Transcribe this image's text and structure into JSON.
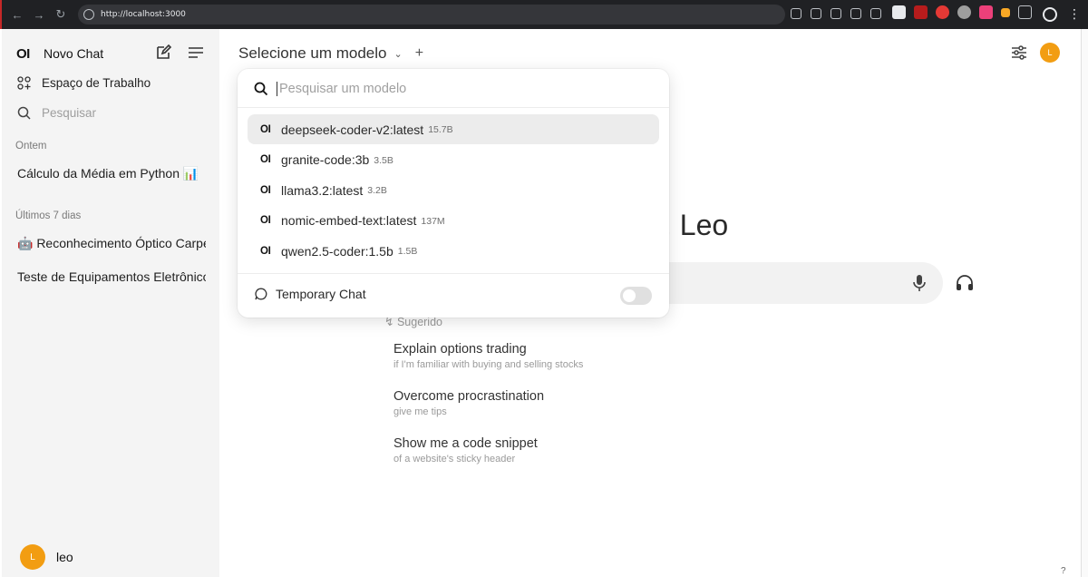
{
  "browser": {
    "url": "http://localhost:3000"
  },
  "sidebar": {
    "logo": "OI",
    "new_chat": "Novo Chat",
    "workspace": "Espaço de Trabalho",
    "search_placeholder": "Pesquisar",
    "groups": [
      {
        "label": "Ontem",
        "chats": [
          "Cálculo da Média em Python 📊"
        ]
      },
      {
        "label": "Últimos 7 dias",
        "chats": [
          "🤖 Reconhecimento Óptico Carpé",
          "Teste de Equipamentos Eletrônicos"
        ]
      }
    ],
    "user": {
      "initial": "L",
      "name": "leo"
    }
  },
  "header": {
    "model_select": "Selecione um modelo",
    "avatar_initial": "L"
  },
  "main": {
    "greeting": ", Leo",
    "suggested_label": "Sugerido",
    "suggestions": [
      {
        "title": "Explain options trading",
        "subtitle": "if I'm familiar with buying and selling stocks"
      },
      {
        "title": "Overcome procrastination",
        "subtitle": "give me tips"
      },
      {
        "title": "Show me a code snippet",
        "subtitle": "of a website's sticky header"
      }
    ],
    "help": "?"
  },
  "dropdown": {
    "search_placeholder": "Pesquisar um modelo",
    "models": [
      {
        "icon": "OI",
        "name": "deepseek-coder-v2:latest",
        "size": "15.7B"
      },
      {
        "icon": "OI",
        "name": "granite-code:3b",
        "size": "3.5B"
      },
      {
        "icon": "OI",
        "name": "llama3.2:latest",
        "size": "3.2B"
      },
      {
        "icon": "OI",
        "name": "nomic-embed-text:latest",
        "size": "137M"
      },
      {
        "icon": "OI",
        "name": "qwen2.5-coder:1.5b",
        "size": "1.5B"
      }
    ],
    "temporary_chat": "Temporary Chat",
    "temporary_chat_enabled": false
  },
  "icons": [
    "back-icon",
    "forward-icon",
    "reload-icon",
    "info-icon",
    "edit-icon",
    "menu-icon",
    "workspace-icon",
    "search-icon",
    "chevron-down-icon",
    "plus-icon",
    "sliders-icon",
    "mic-icon",
    "headset-icon",
    "chat-bubble-icon",
    "sparkle-icon"
  ],
  "colors": {
    "avatar": "#f29d12",
    "sidebar_bg": "#f4f4f4",
    "active_item": "#ececec"
  }
}
